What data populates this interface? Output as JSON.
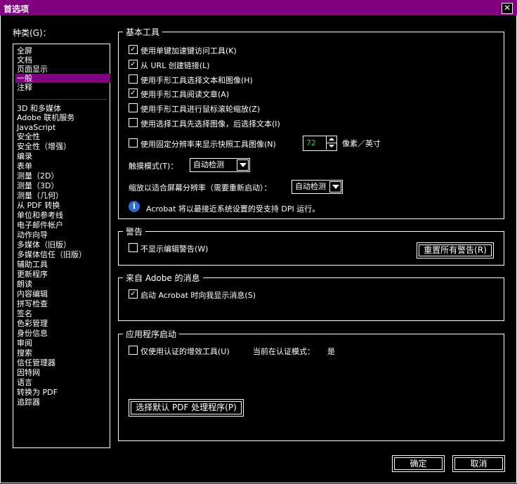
{
  "window": {
    "title": "首选项",
    "close_glyph": "✕"
  },
  "categories": {
    "label": "种类(G)：",
    "items": [
      "全屏",
      "文档",
      "页面显示",
      "一般",
      "注释",
      "3D 和多媒体",
      "Adobe 联机服务",
      "JavaScript",
      "安全性",
      "安全性（增强）",
      "编录",
      "表单",
      "测量（2D）",
      "测量（3D）",
      "测量（几何）",
      "从 PDF 转换",
      "单位和参考线",
      "电子邮件帐户",
      "动作向导",
      "多媒体（旧版）",
      "多媒体信任（旧版）",
      "辅助工具",
      "更新程序",
      "朗读",
      "内容编辑",
      "拼写检查",
      "签名",
      "色彩管理",
      "身份信息",
      "审阅",
      "搜索",
      "信任管理器",
      "因特网",
      "语言",
      "转换为 PDF",
      "追踪器"
    ],
    "selected": "一般"
  },
  "basic_tools": {
    "legend": "基本工具",
    "options": [
      {
        "label": "使用单键加速键访问工具(K)",
        "checked": true
      },
      {
        "label": "从 URL 创建链接(L)",
        "checked": true
      },
      {
        "label": "使用手形工具选择文本和图像(H)",
        "checked": false
      },
      {
        "label": "使用手形工具阅读文章(A)",
        "checked": true
      },
      {
        "label": "使用手形工具进行鼠标滚轮缩放(Z)",
        "checked": false
      },
      {
        "label": "使用选择工具先选择图像，后选择文本(I)",
        "checked": false
      },
      {
        "label": "使用固定分辨率来显示快照工具图像(N)",
        "checked": false
      }
    ],
    "resolution_value": "72",
    "resolution_unit": "像素／英寸",
    "touch_mode_label": "触摸模式(T)：",
    "touch_mode_value": "自动检测",
    "scale_label": "缩放以适合屏幕分辨率（需要重新启动）：",
    "scale_value": "自动检测",
    "info_icon_glyph": "i",
    "info_text": "Acrobat 将以最接近系统设置的受支持 DPI 运行。"
  },
  "warnings": {
    "legend": "警告",
    "option": {
      "label": "不显示编辑警告(W)",
      "checked": false
    },
    "reset_button": "重置所有警告(R)"
  },
  "adobe_messages": {
    "legend": "来自 Adobe 的消息",
    "option": {
      "label": "启动 Acrobat 时向我显示消息(S)",
      "checked": true
    }
  },
  "app_startup": {
    "legend": "应用程序启动",
    "option": {
      "label": "仅使用认证的增效工具(U)",
      "checked": false
    },
    "cert_mode_label": "当前在认证模式：",
    "cert_mode_value": "是",
    "default_pdf_button": "选择默认 PDF 处理程序(P)"
  },
  "footer": {
    "ok": "确定",
    "cancel": "取消"
  }
}
